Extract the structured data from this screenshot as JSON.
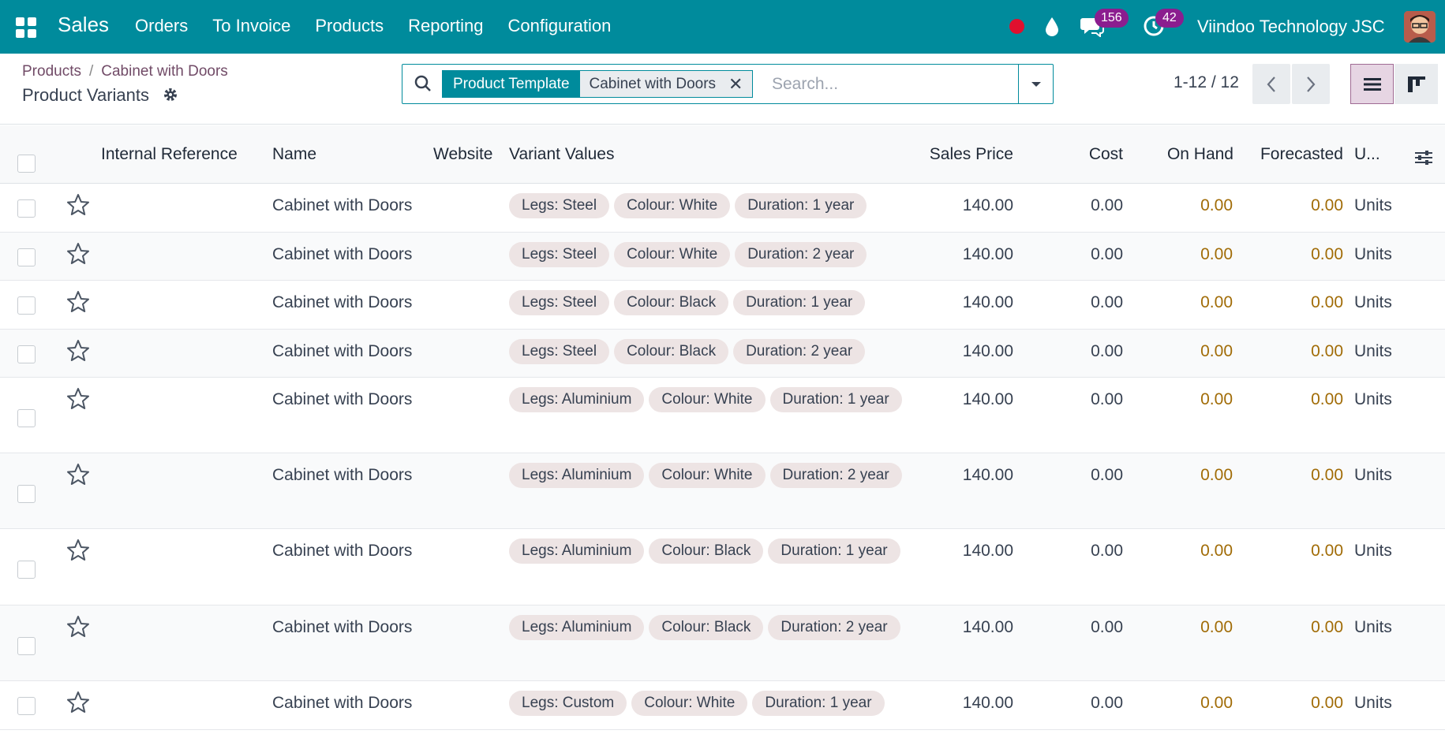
{
  "navbar": {
    "app_name": "Sales",
    "menu": [
      "Orders",
      "To Invoice",
      "Products",
      "Reporting",
      "Configuration"
    ],
    "messages_count": "156",
    "activities_count": "42",
    "company": "Viindoo Technology JSC",
    "icons": {
      "apps": "apps-grid-icon",
      "record": "record-dot-icon",
      "drop": "water-drop-icon",
      "chat": "chat-icon",
      "activity": "activity-clock-icon"
    }
  },
  "control": {
    "breadcrumb": [
      "Products",
      "Cabinet with Doors"
    ],
    "breadcrumb_sep": "/",
    "title": "Product Variants",
    "facet_label": "Product Template",
    "facet_value": "Cabinet with Doors",
    "facet_close": "✕",
    "search_placeholder": "Search...",
    "pager": "1-12 / 12"
  },
  "table": {
    "columns": [
      "Internal Reference",
      "Name",
      "Website",
      "Variant Values",
      "Sales Price",
      "Cost",
      "On Hand",
      "Forecasted",
      "U..."
    ],
    "rows": [
      {
        "name": "Cabinet with Doors",
        "variants": [
          "Legs: Steel",
          "Colour: White",
          "Duration: 1 year"
        ],
        "price": "140.00",
        "cost": "0.00",
        "on_hand": "0.00",
        "forecasted": "0.00",
        "uom": "Units"
      },
      {
        "name": "Cabinet with Doors",
        "variants": [
          "Legs: Steel",
          "Colour: White",
          "Duration: 2 year"
        ],
        "price": "140.00",
        "cost": "0.00",
        "on_hand": "0.00",
        "forecasted": "0.00",
        "uom": "Units"
      },
      {
        "name": "Cabinet with Doors",
        "variants": [
          "Legs: Steel",
          "Colour: Black",
          "Duration: 1 year"
        ],
        "price": "140.00",
        "cost": "0.00",
        "on_hand": "0.00",
        "forecasted": "0.00",
        "uom": "Units"
      },
      {
        "name": "Cabinet with Doors",
        "variants": [
          "Legs: Steel",
          "Colour: Black",
          "Duration: 2 year"
        ],
        "price": "140.00",
        "cost": "0.00",
        "on_hand": "0.00",
        "forecasted": "0.00",
        "uom": "Units"
      },
      {
        "name": "Cabinet with Doors",
        "variants": [
          "Legs: Aluminium",
          "Colour: White",
          "Duration: 1 year"
        ],
        "price": "140.00",
        "cost": "0.00",
        "on_hand": "0.00",
        "forecasted": "0.00",
        "uom": "Units"
      },
      {
        "name": "Cabinet with Doors",
        "variants": [
          "Legs: Aluminium",
          "Colour: White",
          "Duration: 2 year"
        ],
        "price": "140.00",
        "cost": "0.00",
        "on_hand": "0.00",
        "forecasted": "0.00",
        "uom": "Units"
      },
      {
        "name": "Cabinet with Doors",
        "variants": [
          "Legs: Aluminium",
          "Colour: Black",
          "Duration: 1 year"
        ],
        "price": "140.00",
        "cost": "0.00",
        "on_hand": "0.00",
        "forecasted": "0.00",
        "uom": "Units"
      },
      {
        "name": "Cabinet with Doors",
        "variants": [
          "Legs: Aluminium",
          "Colour: Black",
          "Duration: 2 year"
        ],
        "price": "140.00",
        "cost": "0.00",
        "on_hand": "0.00",
        "forecasted": "0.00",
        "uom": "Units"
      },
      {
        "name": "Cabinet with Doors",
        "variants": [
          "Legs: Custom",
          "Colour: White",
          "Duration: 1 year"
        ],
        "price": "140.00",
        "cost": "0.00",
        "on_hand": "0.00",
        "forecasted": "0.00",
        "uom": "Units"
      }
    ]
  },
  "colors": {
    "navbar": "#008b9c",
    "accent": "#714b67",
    "badge": "#8b1d8f",
    "warning_text": "#a16c07",
    "tag_bg": "#ede4e4"
  }
}
